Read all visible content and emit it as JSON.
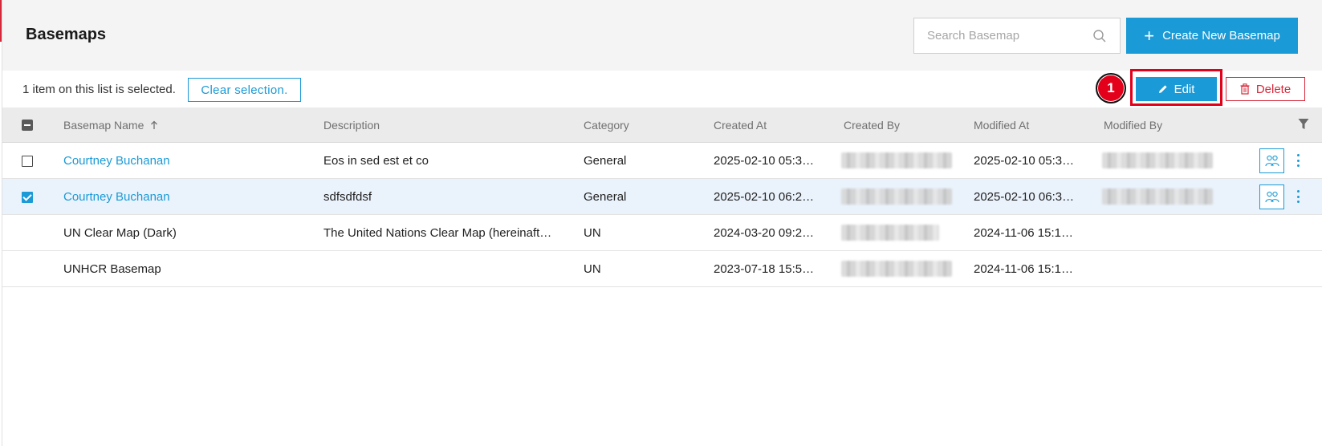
{
  "header": {
    "title": "Basemaps",
    "search_placeholder": "Search Basemap",
    "create_label": "Create New Basemap"
  },
  "selection_bar": {
    "status_text": "1 item on this list is selected.",
    "clear_label": "Clear selection.",
    "step_number": "1",
    "edit_label": "Edit",
    "delete_label": "Delete"
  },
  "table": {
    "columns": {
      "name": "Basemap Name",
      "description": "Description",
      "category": "Category",
      "created_at": "Created At",
      "created_by": "Created By",
      "modified_at": "Modified At",
      "modified_by": "Modified By"
    },
    "sort": {
      "column": "name",
      "direction": "ascending"
    },
    "rows": [
      {
        "name": "Courtney Buchanan",
        "description": "Eos in sed est et co",
        "category": "General",
        "created_at": "2025-02-10 05:3…",
        "modified_at": "2025-02-10 05:3…",
        "checked": false,
        "is_link": true
      },
      {
        "name": "Courtney Buchanan",
        "description": "sdfsdfdsf",
        "category": "General",
        "created_at": "2025-02-10 06:2…",
        "modified_at": "2025-02-10 06:3…",
        "checked": true,
        "is_link": true
      },
      {
        "name": "UN Clear Map (Dark)",
        "description": "The United Nations Clear Map (hereinaft…",
        "category": "UN",
        "created_at": "2024-03-20 09:2…",
        "modified_at": "2024-11-06 15:1…",
        "checked": false,
        "is_link": false
      },
      {
        "name": "UNHCR Basemap",
        "description": "",
        "category": "UN",
        "created_at": "2023-07-18 15:5…",
        "modified_at": "2024-11-06 15:1…",
        "checked": false,
        "is_link": false
      }
    ]
  },
  "colors": {
    "primary": "#1a9ad6",
    "danger": "#d6283b",
    "annotation": "#e3001b",
    "selected_row": "#eaf2fb"
  },
  "icons": [
    "search-icon",
    "plus-icon",
    "pencil-icon",
    "trash-icon",
    "sort-arrow-up-icon",
    "filter-icon",
    "share-users-icon",
    "kebab-menu-icon"
  ]
}
